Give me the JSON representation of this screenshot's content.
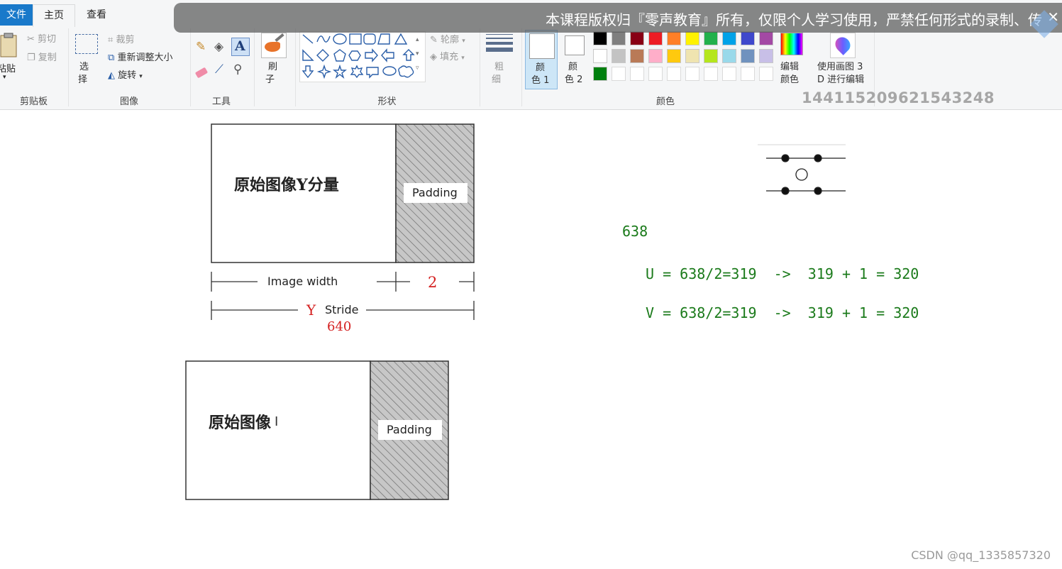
{
  "ribbon": {
    "tabs": {
      "file": "文件",
      "home": "主页",
      "view": "查看"
    },
    "clipboard": {
      "paste": "粘贴",
      "cut": "剪切",
      "copy": "复制",
      "group": "剪贴板"
    },
    "image": {
      "select_1": "选",
      "select_2": "择",
      "crop": "裁剪",
      "resize": "重新调整大小",
      "rotate": "旋转",
      "group": "图像"
    },
    "tools": {
      "group": "工具"
    },
    "brush": {
      "label_1": "刷",
      "label_2": "子"
    },
    "shapes": {
      "outline": "轮廓",
      "fill": "填充",
      "group": "形状"
    },
    "size": {
      "label_1": "粗",
      "label_2": "细"
    },
    "colors": {
      "color1_1": "颜",
      "color1_2": "色 1",
      "color2_1": "颜",
      "color2_2": "色 2",
      "edit_1": "编辑",
      "edit_2": "颜色",
      "paint3d_1": "使用画图 3",
      "paint3d_2": "D 进行编辑",
      "group": "颜色",
      "palette_row1": [
        "#000000",
        "#7f7f7f",
        "#880015",
        "#ed1c24",
        "#ff7f27",
        "#fff200",
        "#22b14c",
        "#00a2e8",
        "#3f48cc",
        "#a349a4"
      ],
      "palette_row2": [
        "#ffffff",
        "#c3c3c3",
        "#b97a57",
        "#ffaec9",
        "#ffc90e",
        "#efe4b0",
        "#b5e61d",
        "#99d9ea",
        "#7092be",
        "#c8bfe7"
      ],
      "palette_row3": [
        "#007f0e"
      ]
    }
  },
  "banner": {
    "text": "本课程版权归『零声教育』所有，仅限个人学习使用，严禁任何形式的录制、传",
    "close": "✕"
  },
  "overlay_id": "144115209621543248",
  "diagram1": {
    "title": "原始图像Y分量",
    "padding": "Padding",
    "image_width": "Image width",
    "pad_value": "2",
    "y_label": "Y",
    "stride": "Stride",
    "stride_value": "640"
  },
  "diagram2": {
    "title": "原始图像",
    "padding": "Padding"
  },
  "notes": {
    "n638": "638",
    "u_line": "U = 638/2=319  ->  319 + 1 = 320",
    "v_line": "V = 638/2=319  ->  319 + 1 = 320"
  },
  "watermark": "CSDN @qq_1335857320"
}
